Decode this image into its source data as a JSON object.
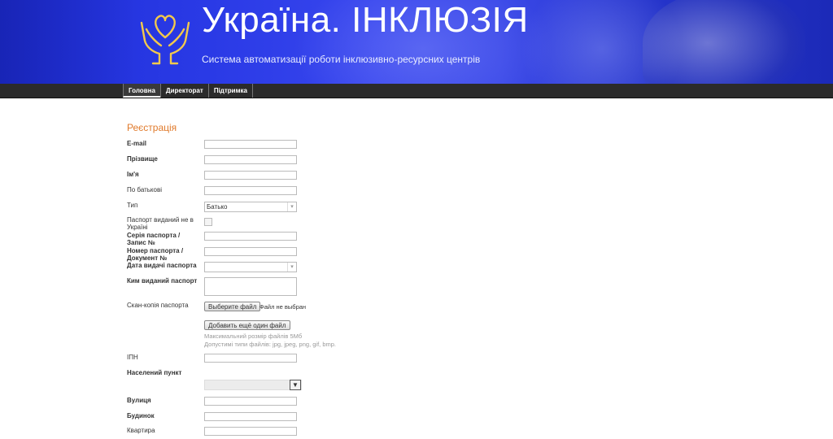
{
  "header": {
    "title": "Україна. ІНКЛЮЗІЯ",
    "subtitle": "Система автоматизації роботи інклюзивно-ресурсних центрів",
    "brand_color": "#f2c94c"
  },
  "nav": {
    "items": [
      {
        "label": "Головна"
      },
      {
        "label": "Директорат"
      },
      {
        "label": "Підтримка"
      }
    ]
  },
  "form": {
    "heading": "Реєстрація",
    "fields": {
      "email": {
        "label": "E-mail"
      },
      "surname": {
        "label": "Прізвище"
      },
      "name": {
        "label": "Ім'я"
      },
      "patronymic": {
        "label": "По батькові"
      },
      "type": {
        "label": "Тип",
        "value": "Батько"
      },
      "foreign_passport": {
        "label": "Паспорт виданий не в Україні"
      },
      "passport_series": {
        "label": "Серія паспорта / Запис №"
      },
      "passport_number": {
        "label": "Номер паспорта / Документ №"
      },
      "passport_date": {
        "label": "Дата видачі паспорта"
      },
      "issued_by": {
        "label": "Ким виданий паспорт"
      },
      "scan": {
        "label": "Скан-копія паспорта",
        "choose_button": "Выберите файл",
        "no_file": "Файл не выбран",
        "add_button": "Добавить ещё один файл",
        "max_size": "Максимальний розмір файлів 5Мб",
        "allowed_types": "Допустимі типи файлів: jpg, jpeg, png, gif, bmp."
      },
      "tin": {
        "label": "ІПН"
      },
      "locality": {
        "label": "Населений пункт"
      },
      "street": {
        "label": "Вулиця"
      },
      "building": {
        "label": "Будинок"
      },
      "apartment": {
        "label": "Квартира"
      }
    }
  }
}
